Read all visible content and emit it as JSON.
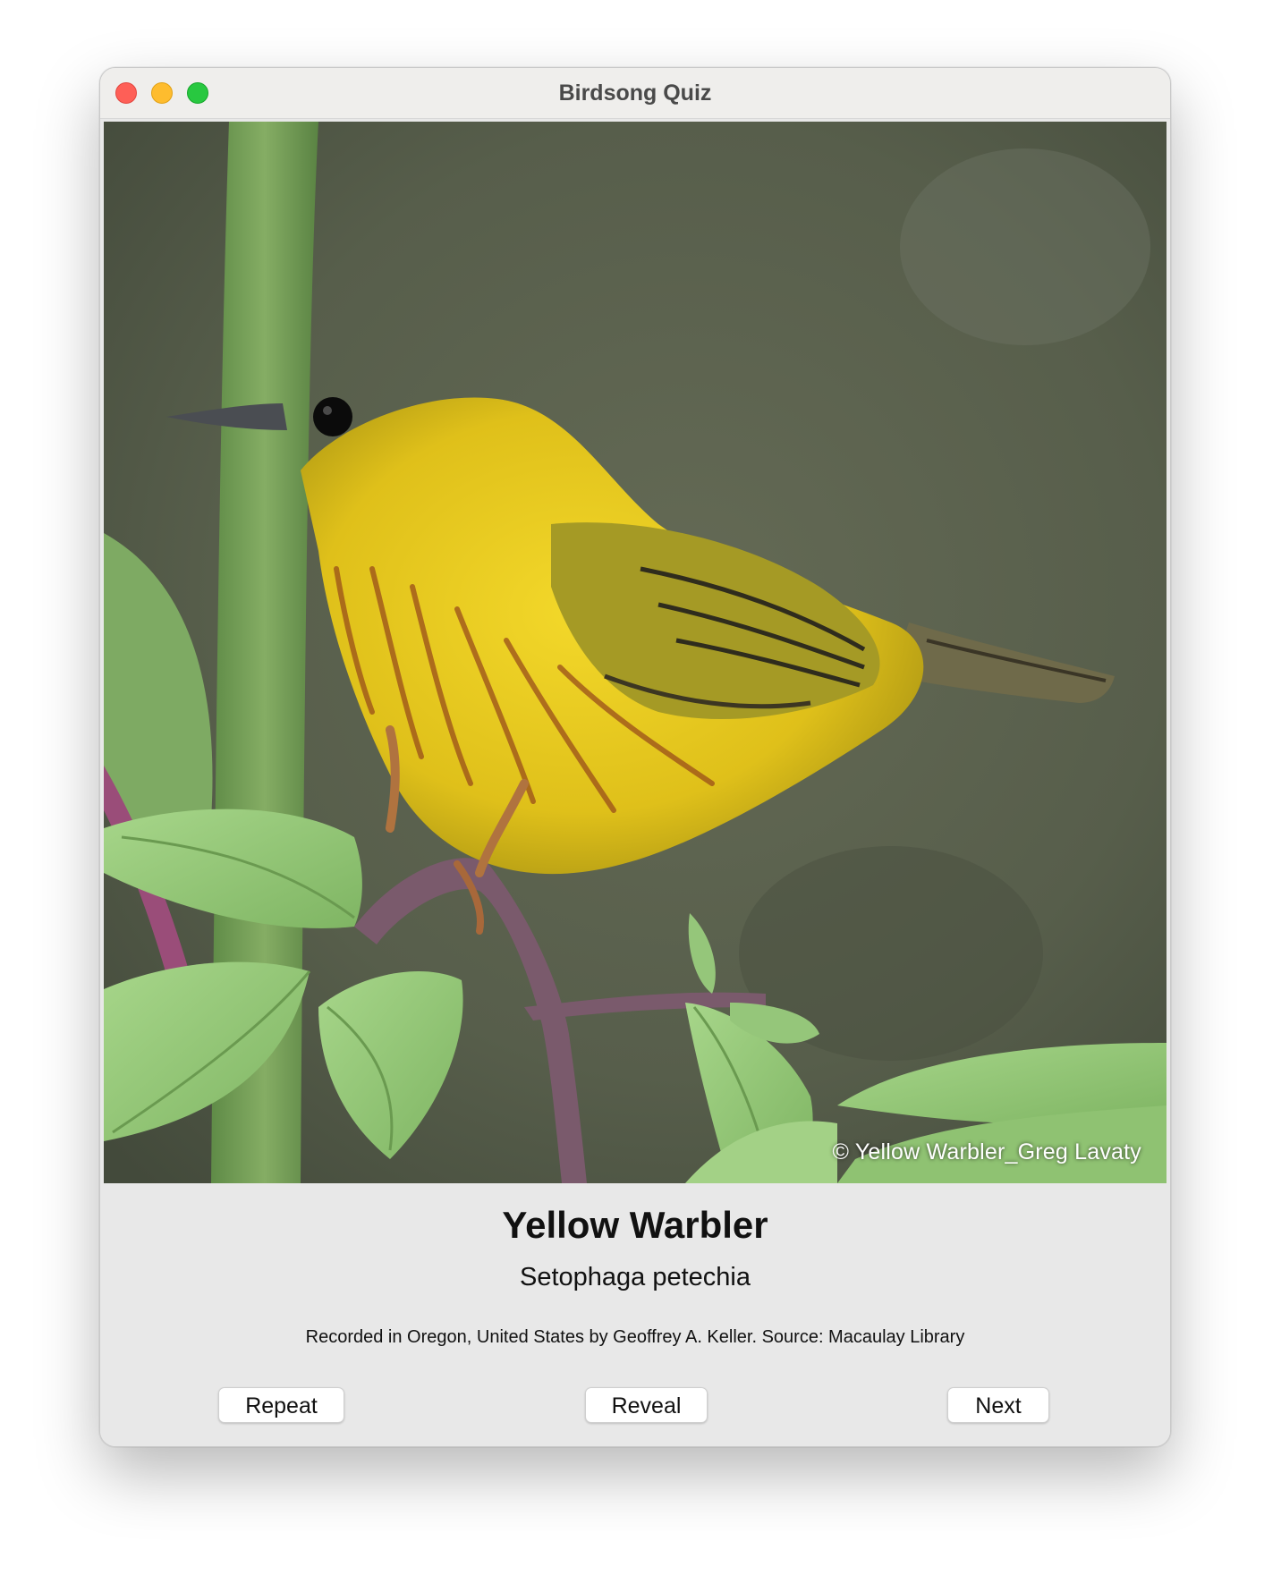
{
  "window": {
    "title": "Birdsong Quiz"
  },
  "photo": {
    "subject": "yellow-warbler-photo",
    "credit": "© Yellow Warbler_Greg Lavaty"
  },
  "species": {
    "common_name": "Yellow Warbler",
    "scientific_name": "Setophaga petechia"
  },
  "recording": {
    "attribution": "Recorded in Oregon, United States by Geoffrey A. Keller. Source: Macaulay Library"
  },
  "buttons": {
    "repeat": "Repeat",
    "reveal": "Reveal",
    "next": "Next"
  },
  "colors": {
    "close": "#fe5f57",
    "minimize": "#febc2e",
    "zoom": "#28c840",
    "bird_yellow": "#e3c81a",
    "background_green": "#5a6250"
  }
}
